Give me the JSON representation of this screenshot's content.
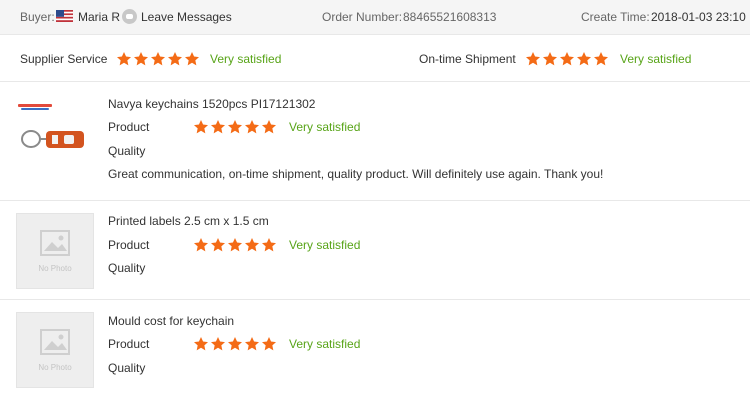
{
  "header": {
    "buyer_label": "Buyer:",
    "buyer_name": "Maria R",
    "buyer_flag": "us-flag-icon",
    "leave_messages": "Leave Messages",
    "order_label": "Order Number:",
    "order_number": "88465521608313",
    "create_label": "Create Time:",
    "create_time": "2018-01-03 23:10"
  },
  "supplier": {
    "service_label": "Supplier Service",
    "service_rating": 5,
    "service_text": "Very satisfied",
    "shipment_label": "On-time Shipment",
    "shipment_rating": 5,
    "shipment_text": "Very satisfied"
  },
  "items": [
    {
      "name": "Navya keychains 1520pcs PI17121302",
      "product_label": "Product",
      "quality_label": "Quality",
      "rating": 5,
      "rating_text": "Very satisfied",
      "comment": "Great communication, on-time shipment, quality product. Will definitely use again. Thank you!",
      "image": "keychain-photo"
    },
    {
      "name": "Printed labels 2.5 cm x 1.5 cm",
      "product_label": "Product",
      "quality_label": "Quality",
      "rating": 5,
      "rating_text": "Very satisfied",
      "no_photo": "No Photo"
    },
    {
      "name": "Mould cost for keychain",
      "product_label": "Product",
      "quality_label": "Quality",
      "rating": 5,
      "rating_text": "Very satisfied",
      "no_photo": "No Photo"
    }
  ],
  "colors": {
    "star": "#f46b16",
    "satisfied": "#58a418",
    "link": "#3a6fc4"
  }
}
